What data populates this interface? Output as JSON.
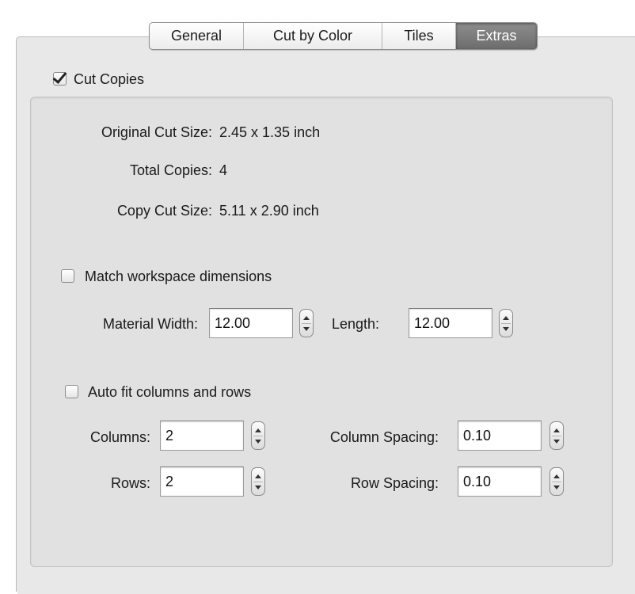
{
  "tabs": [
    {
      "label": "General"
    },
    {
      "label": "Cut by Color"
    },
    {
      "label": "Tiles"
    },
    {
      "label": "Extras"
    }
  ],
  "selected_tab": "Extras",
  "cut_copies": {
    "label": "Cut Copies",
    "checked": true
  },
  "info": {
    "original_cut_size_label": "Original Cut Size:",
    "original_cut_size_value": "2.45 x 1.35 inch",
    "total_copies_label": "Total Copies:",
    "total_copies_value": "4",
    "copy_cut_size_label": "Copy Cut Size:",
    "copy_cut_size_value": "5.11 x 2.90 inch"
  },
  "match_workspace": {
    "label": "Match workspace dimensions",
    "checked": false
  },
  "material": {
    "width_label": "Material Width:",
    "width_value": "12.00",
    "length_label": "Length:",
    "length_value": "12.00"
  },
  "auto_fit": {
    "label": "Auto fit columns and rows",
    "checked": false
  },
  "grid": {
    "columns_label": "Columns:",
    "columns_value": "2",
    "rows_label": "Rows:",
    "rows_value": "2",
    "column_spacing_label": "Column Spacing:",
    "column_spacing_value": "0.10",
    "row_spacing_label": "Row Spacing:",
    "row_spacing_value": "0.10"
  },
  "colors": {
    "selected_tab_bg": "#7a7a7a",
    "panel_bg": "#e8e8e8",
    "group_bg": "#e1e1e1"
  }
}
